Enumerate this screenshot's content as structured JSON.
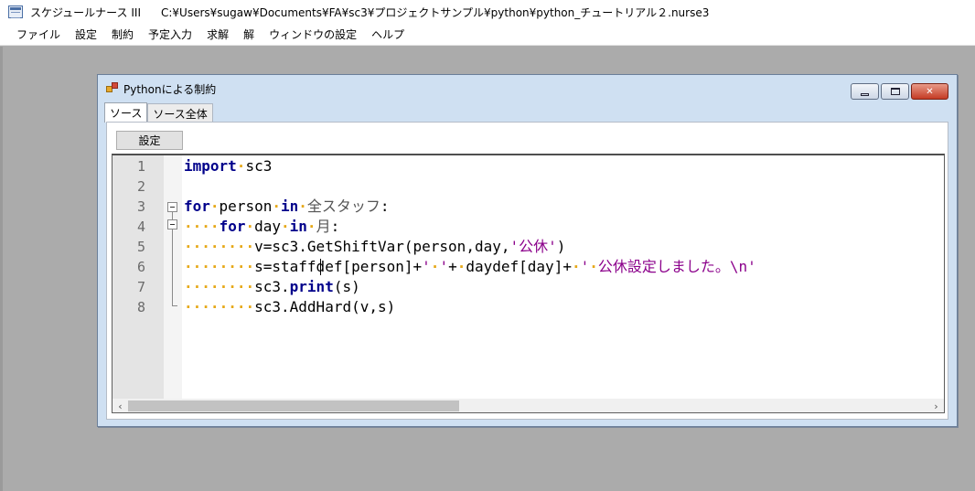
{
  "app": {
    "name": "スケジュールナース III",
    "path": "C:¥Users¥sugaw¥Documents¥FA¥sc3¥プロジェクトサンプル¥python¥python_チュートリアル２.nurse3"
  },
  "menu": [
    "ファイル",
    "設定",
    "制約",
    "予定入力",
    "求解",
    "解",
    "ウィンドウの設定",
    "ヘルプ"
  ],
  "child_window": {
    "title": "Pythonによる制約",
    "tabs": [
      "ソース",
      "ソース全体"
    ],
    "active_tab": 0,
    "settings_button": "設定"
  },
  "editor": {
    "line_numbers": [
      "1",
      "2",
      "3",
      "4",
      "5",
      "6",
      "7",
      "8"
    ],
    "lines": [
      "import·sc3",
      "",
      "for·person·in·全スタッフ:",
      "····for·day·in·月:",
      "········v=sc3.GetShiftVar(person,day,'公休')",
      "········s=staffdef[person]+'·'+·daydef[day]+·'·公休設定しました。\\n'",
      "········sc3.print(s)",
      "········sc3.AddHard(v,s)"
    ]
  },
  "colors": {
    "keyword": "#00008b",
    "string": "#8b008b",
    "whitespace_marker": "#e6a817",
    "mdi_background": "#ababab",
    "window_frame": "#cfe0f2"
  }
}
